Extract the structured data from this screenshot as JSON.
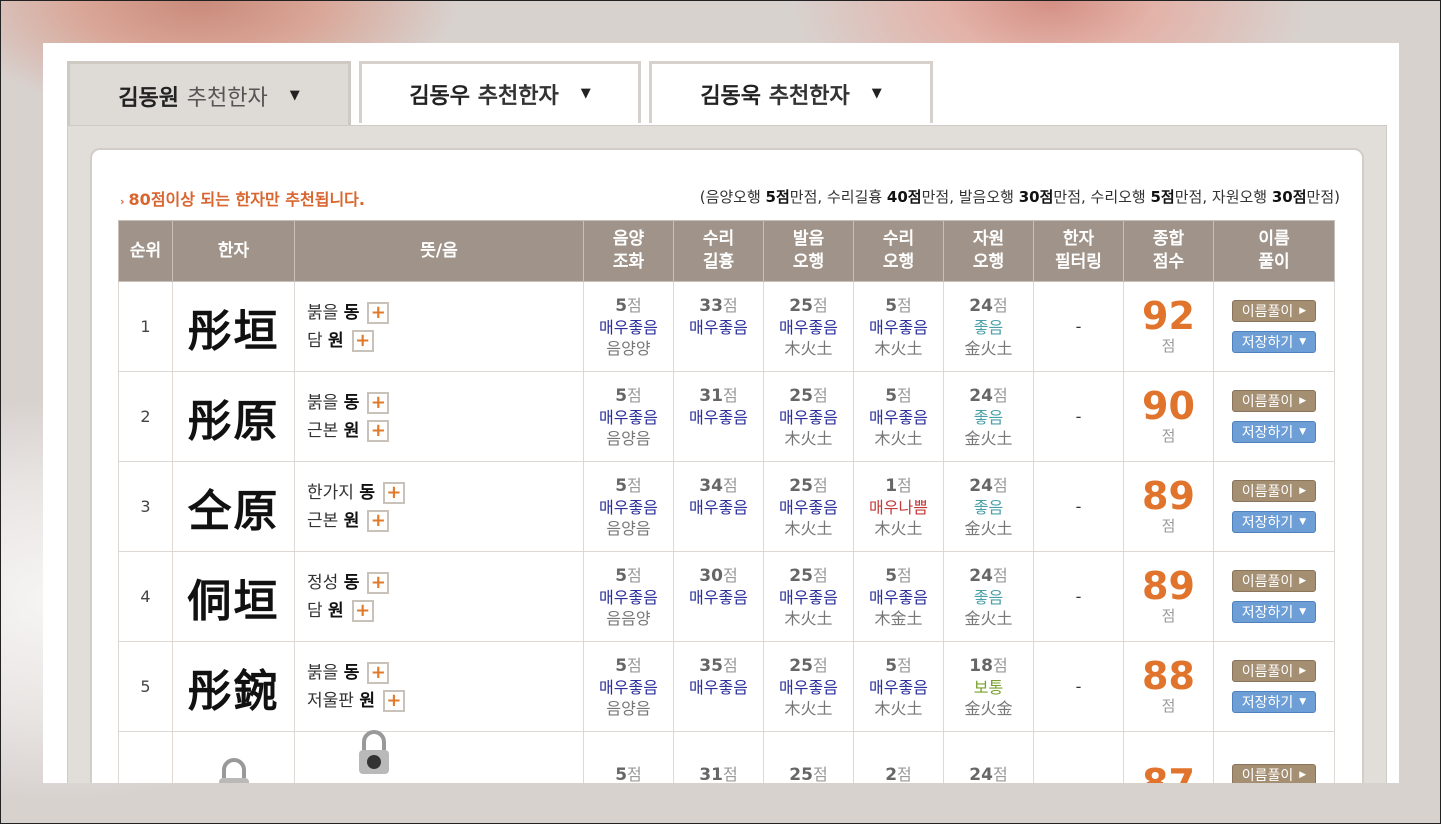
{
  "tabs": [
    {
      "name": "김동원",
      "suffix": "추천한자",
      "active": true
    },
    {
      "name": "김동우",
      "suffix": "추천한자",
      "active": false
    },
    {
      "name": "김동욱",
      "suffix": "추천한자",
      "active": false
    }
  ],
  "note": "80점이상 되는 한자만 추천됩니다.",
  "scoring": {
    "open": "(",
    "p1": "음양오행 ",
    "v1": "5점",
    "s1": "만점, ",
    "p2": "수리길흉 ",
    "v2": "40점",
    "s2": "만점, ",
    "p3": "발음오행 ",
    "v3": "30점",
    "s3": "만점, ",
    "p4": "수리오행 ",
    "v4": "5점",
    "s4": "만점, ",
    "p5": "자원오행 ",
    "v5": "30점",
    "s5": "만점)"
  },
  "headers": {
    "rank": "순위",
    "hanja": "한자",
    "meaning": "뜻/음",
    "yinyang": [
      "음양",
      "조화"
    ],
    "suri": [
      "수리",
      "길흉"
    ],
    "pron": [
      "발음",
      "오행"
    ],
    "suri_elem": [
      "수리",
      "오행"
    ],
    "source": [
      "자원",
      "오행"
    ],
    "filter": [
      "한자",
      "필터링"
    ],
    "total": [
      "종합",
      "점수"
    ],
    "interp": [
      "이름",
      "풀이"
    ]
  },
  "unit": "점",
  "btn_interp": "이름풀이",
  "btn_save": "저장하기",
  "rows": [
    {
      "rank": "1",
      "hanja": "彤垣",
      "m1": "붉을",
      "r1": "동",
      "m2": "담",
      "r2": "원",
      "yy": "5",
      "yy_l": "매우좋음",
      "yy_e": "음양양",
      "su": "33",
      "su_l": "매우좋음",
      "pr": "25",
      "pr_l": "매우좋음",
      "pr_e": "木火土",
      "se": "5",
      "se_l": "매우좋음",
      "se_e": "木火土",
      "so": "24",
      "so_l": "좋음",
      "so_e": "金火土",
      "filter": "-",
      "total": "92"
    },
    {
      "rank": "2",
      "hanja": "彤原",
      "m1": "붉을",
      "r1": "동",
      "m2": "근본",
      "r2": "원",
      "yy": "5",
      "yy_l": "매우좋음",
      "yy_e": "음양음",
      "su": "31",
      "su_l": "매우좋음",
      "pr": "25",
      "pr_l": "매우좋음",
      "pr_e": "木火土",
      "se": "5",
      "se_l": "매우좋음",
      "se_e": "木火土",
      "so": "24",
      "so_l": "좋음",
      "so_e": "金火土",
      "filter": "-",
      "total": "90"
    },
    {
      "rank": "3",
      "hanja": "仝原",
      "m1": "한가지",
      "r1": "동",
      "m2": "근본",
      "r2": "원",
      "yy": "5",
      "yy_l": "매우좋음",
      "yy_e": "음양음",
      "su": "34",
      "su_l": "매우좋음",
      "pr": "25",
      "pr_l": "매우좋음",
      "pr_e": "木火土",
      "se": "1",
      "se_l": "매우나쁨",
      "se_e": "木火土",
      "so": "24",
      "so_l": "좋음",
      "so_e": "金火土",
      "filter": "-",
      "total": "89"
    },
    {
      "rank": "4",
      "hanja": "侗垣",
      "m1": "정성",
      "r1": "동",
      "m2": "담",
      "r2": "원",
      "yy": "5",
      "yy_l": "매우좋음",
      "yy_e": "음음양",
      "su": "30",
      "su_l": "매우좋음",
      "pr": "25",
      "pr_l": "매우좋음",
      "pr_e": "木火土",
      "se": "5",
      "se_l": "매우좋음",
      "se_e": "木金土",
      "so": "24",
      "so_l": "좋음",
      "so_e": "金火土",
      "filter": "-",
      "total": "89"
    },
    {
      "rank": "5",
      "hanja": "彤鋺",
      "m1": "붉을",
      "r1": "동",
      "m2": "저울판",
      "r2": "원",
      "yy": "5",
      "yy_l": "매우좋음",
      "yy_e": "음양음",
      "su": "35",
      "su_l": "매우좋음",
      "pr": "25",
      "pr_l": "매우좋음",
      "pr_e": "木火土",
      "se": "5",
      "se_l": "매우좋음",
      "se_e": "木火土",
      "so": "18",
      "so_l": "보통",
      "so_e": "金火金",
      "filter": "-",
      "total": "88"
    }
  ],
  "partial_row": {
    "yy": "5",
    "su": "31",
    "pr": "25",
    "se": "2",
    "so": "24",
    "total": "87"
  }
}
